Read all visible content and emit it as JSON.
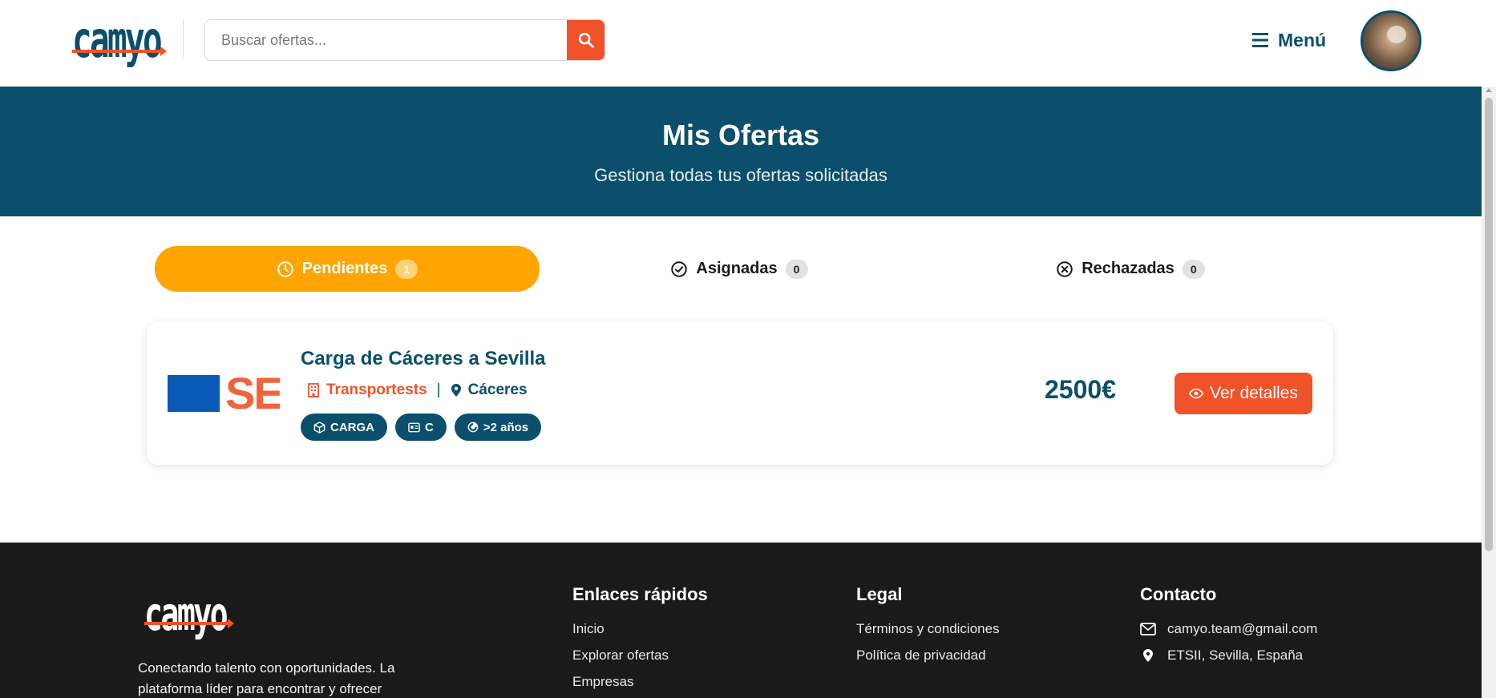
{
  "header": {
    "logo_text": "camyo",
    "search_placeholder": "Buscar ofertas...",
    "menu_label": "Menú"
  },
  "hero": {
    "title": "Mis Ofertas",
    "subtitle": "Gestiona todas tus ofertas solicitadas"
  },
  "tabs": [
    {
      "label": "Pendientes",
      "count": "1",
      "active": true,
      "icon": "clock-icon"
    },
    {
      "label": "Asignadas",
      "count": "0",
      "active": false,
      "icon": "check-circle-icon"
    },
    {
      "label": "Rechazadas",
      "count": "0",
      "active": false,
      "icon": "x-circle-icon"
    }
  ],
  "offers": [
    {
      "logo_text": "SE",
      "title": "Carga de Cáceres a Sevilla",
      "company": "Transportests",
      "location": "Cáceres",
      "tags": [
        {
          "label": "CARGA",
          "icon": "box-icon"
        },
        {
          "label": "C",
          "icon": "license-icon"
        },
        {
          "label": ">2 años",
          "icon": "experience-icon"
        }
      ],
      "price": "2500€",
      "details_label": "Ver detalles"
    }
  ],
  "footer": {
    "logo_text": "camyo",
    "description": "Conectando talento con oportunidades. La plataforma líder para encontrar y ofrecer",
    "quick_links": {
      "title": "Enlaces rápidos",
      "items": [
        "Inicio",
        "Explorar ofertas",
        "Empresas"
      ]
    },
    "legal": {
      "title": "Legal",
      "items": [
        "Términos y condiciones",
        "Política de privacidad"
      ]
    },
    "contact": {
      "title": "Contacto",
      "email": "camyo.team@gmail.com",
      "address": "ETSII, Sevilla, España"
    }
  },
  "colors": {
    "primary": "#0b4f6c",
    "accent": "#f0532a",
    "tab_active": "#fea501",
    "footer_bg": "#1a1a1a"
  }
}
